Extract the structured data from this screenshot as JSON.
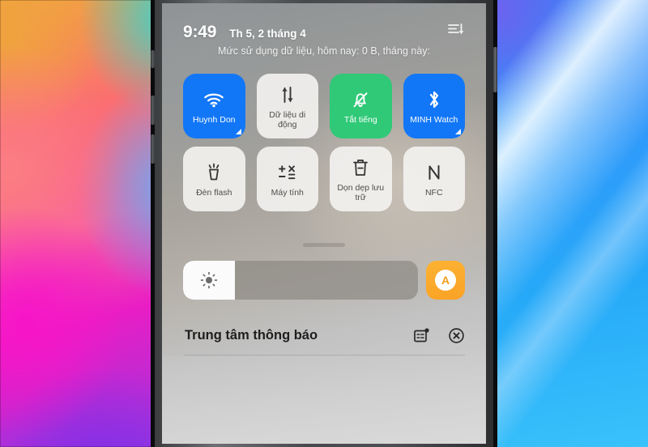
{
  "statusbar": {
    "clock": "9:49",
    "date": "Th 5, 2 tháng 4",
    "sort_icon": "sort-descending-icon",
    "data_usage": "Mức sử dụng dữ liệu, hôm nay: 0 B, tháng này:"
  },
  "quick_settings": {
    "tiles": [
      {
        "label": "Huynh Don",
        "icon": "wifi-icon",
        "state": "on",
        "style": "on-blue",
        "flag": true
      },
      {
        "label": "Dữ liệu di động",
        "icon": "mobile-data-icon",
        "state": "off",
        "style": "off",
        "flag": false
      },
      {
        "label": "Tắt tiếng",
        "icon": "bell-muted-icon",
        "state": "on",
        "style": "on-green",
        "flag": false
      },
      {
        "label": "MINH Watch",
        "icon": "bluetooth-icon",
        "state": "on",
        "style": "on-blue",
        "flag": true
      },
      {
        "label": "Đèn flash",
        "icon": "flashlight-icon",
        "state": "off",
        "style": "off",
        "flag": false
      },
      {
        "label": "Máy tính",
        "icon": "calculator-icon",
        "state": "off",
        "style": "off",
        "flag": false
      },
      {
        "label": "Dọn dẹp lưu trữ",
        "icon": "trash-cleanup-icon",
        "state": "off",
        "style": "off",
        "flag": false
      },
      {
        "label": "NFC",
        "icon": "nfc-icon",
        "state": "off",
        "style": "off",
        "flag": false
      }
    ]
  },
  "brightness": {
    "icon": "brightness-sun-icon",
    "level_percent": 22,
    "auto_label": "A",
    "auto_icon": "auto-brightness-icon"
  },
  "notifications": {
    "title": "Trung tâm thông báo",
    "settings_icon": "notification-settings-icon",
    "clear_all_icon": "clear-all-circle-x-icon"
  },
  "device": {
    "buttons": [
      "mute-switch",
      "volume-up-button",
      "volume-down-button",
      "power-button"
    ]
  },
  "colors": {
    "tile_on_blue": "#1277f7",
    "tile_on_green": "#2fc977",
    "tile_off": "#f4f3f1",
    "auto_orange": "#f9a226",
    "text_dark": "#1e1e1e"
  }
}
